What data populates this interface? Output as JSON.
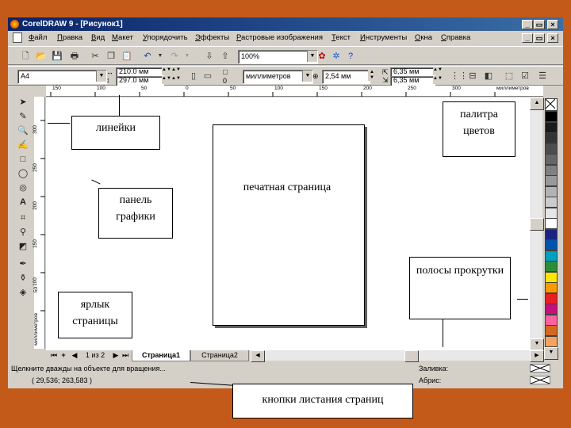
{
  "window": {
    "title": "CorelDRAW 9 - [Рисунок1]",
    "controls": [
      "_",
      "▭",
      "×"
    ]
  },
  "menu": [
    "Файл",
    "Правка",
    "Вид",
    "Макет",
    "Упорядочить",
    "Эффекты",
    "Растровые изображения",
    "Текст",
    "Инструменты",
    "Окна",
    "Справка"
  ],
  "toolbar1": {
    "zoom": "100%"
  },
  "toolbar2": {
    "paper": "A4",
    "width": "210.0 мм",
    "height": "297.0 мм",
    "pages": "0",
    "units": "миллиметров",
    "nudge": "2,54 мм",
    "dup_x": "6,35 мм",
    "dup_y": "6,35 мм"
  },
  "ruler": {
    "h_ticks": [
      "150",
      "100",
      "50",
      "0",
      "50",
      "100",
      "150",
      "200",
      "250",
      "300",
      "350"
    ],
    "h_unit": "миллиметров",
    "v_ticks": [
      "300",
      "250",
      "200",
      "150",
      "100",
      "50"
    ],
    "v_unit": "миллиметров"
  },
  "page_nav": {
    "counter": "1 из 2",
    "tabs": [
      "Страница1",
      "Страница2"
    ]
  },
  "status": {
    "hint": "Щелкните дважды на объекте для вращения...",
    "coords": "( 29,536; 263,583 )",
    "fill_label": "Заливка:",
    "outline_label": "Абрис:"
  },
  "palette_colors": [
    "#000000",
    "#1a1a1a",
    "#333333",
    "#4d4d4d",
    "#666666",
    "#808080",
    "#999999",
    "#b3b3b3",
    "#cccccc",
    "#e6e6e6",
    "#ffffff",
    "#1a237e",
    "#0055aa",
    "#00a0c0",
    "#2e8b3a",
    "#ffe600",
    "#ff9900",
    "#e82020",
    "#c8107a",
    "#ff60a0",
    "#d2691e",
    "#f4a460",
    "#ffb0c8"
  ],
  "callouts": {
    "rulers": "линейки",
    "palette": "палитра цветов",
    "toolbox": "панель графики",
    "page": "печатная страница",
    "scrollbars": "полосы прокрутки",
    "page_tab": "ярлык страницы",
    "page_buttons": "кнопки листания страниц"
  }
}
